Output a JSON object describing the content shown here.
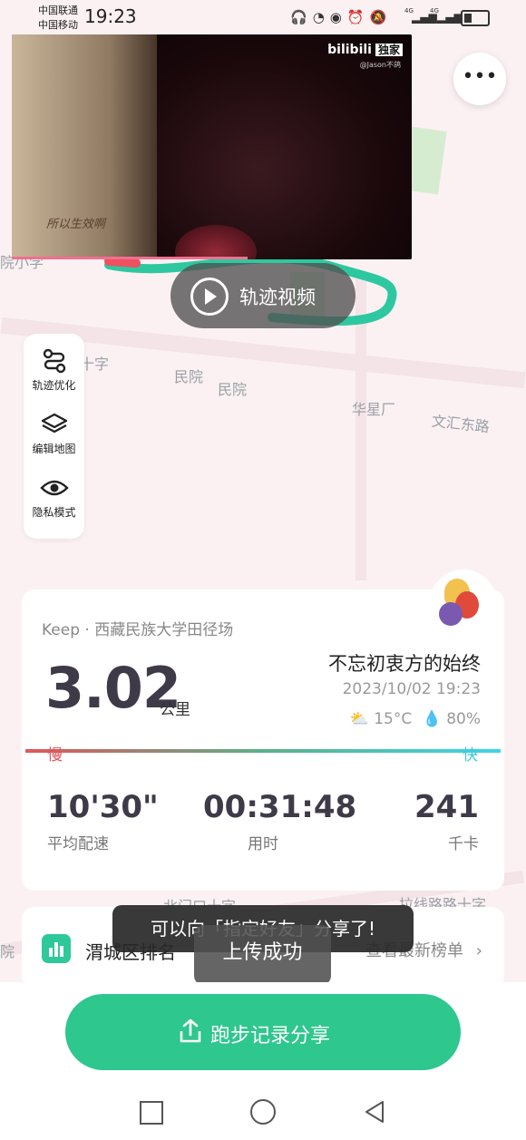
{
  "status": {
    "carrier1": "中国联通",
    "carrier2": "中国移动",
    "time": "19:23",
    "net1": "4G",
    "net2": "4G"
  },
  "map": {
    "labels": [
      "院小学",
      "十字",
      "民院",
      "民院",
      "华星厂",
      "文汇东路",
      "北门口十字",
      "拉线路路十字",
      "院"
    ]
  },
  "video": {
    "logo": "bilibili",
    "badge": "独家",
    "uploader": "@Jason不鸽",
    "subtitle": "所以生效啊"
  },
  "trajectory_button": {
    "label": "轨迹视频"
  },
  "side_menu": {
    "items": [
      {
        "label": "轨迹优化",
        "icon": "route-icon"
      },
      {
        "label": "编辑地图",
        "icon": "layers-icon"
      },
      {
        "label": "隐私模式",
        "icon": "eye-icon"
      }
    ]
  },
  "record": {
    "location": "Keep · 西藏民族大学田径场",
    "distance": "3.02",
    "unit": "公里",
    "run_name": "不忘初衷方的始终",
    "datetime": "2023/10/02 19:23",
    "temperature": "15°C",
    "humidity": "80%",
    "slow_label": "慢",
    "fast_label": "快",
    "stats": [
      {
        "value": "10'30\"",
        "label": "平均配速"
      },
      {
        "value": "00:31:48",
        "label": "用时"
      },
      {
        "value": "241",
        "label": "千卡"
      }
    ]
  },
  "rank": {
    "title": "渭城区排名",
    "right": "查看最新榜单"
  },
  "toasts": {
    "share_hint": "可以向「指定好友」分享了!",
    "upload": "上传成功"
  },
  "share_button": {
    "label": "跑步记录分享"
  }
}
